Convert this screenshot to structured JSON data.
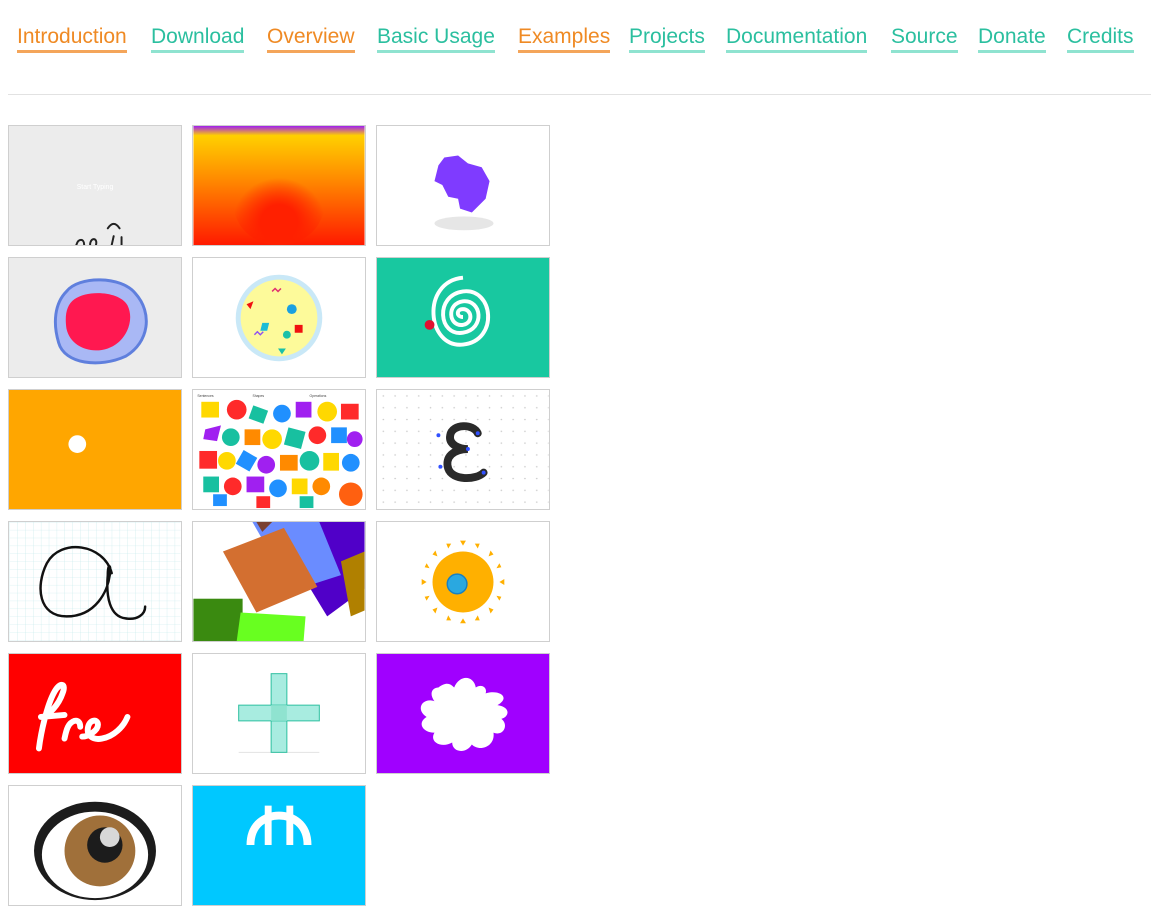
{
  "nav": {
    "items": [
      {
        "label": "Introduction"
      },
      {
        "label": "Download"
      },
      {
        "label": "Overview"
      },
      {
        "label": "Basic Usage"
      },
      {
        "label": "Examples"
      },
      {
        "label": "Projects"
      },
      {
        "label": "Documentation"
      },
      {
        "label": "Source"
      },
      {
        "label": "Donate"
      },
      {
        "label": "Credits"
      }
    ]
  },
  "colors": {
    "link": "#2bbf9f",
    "link_active": "#ef8a24"
  },
  "examples": {
    "tile1_caption": "Start Typing",
    "tile8_headers": [
      "Sentences",
      "Shapes",
      "Operations"
    ]
  }
}
